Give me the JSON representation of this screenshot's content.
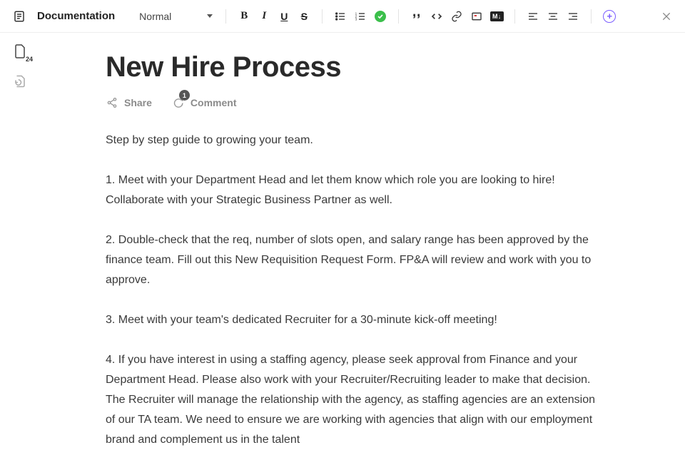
{
  "toolbar": {
    "doc_type": "Documentation",
    "style_dropdown": "Normal",
    "bold": "B",
    "italic": "I",
    "underline": "U",
    "strike": "S",
    "md_label": "M↓",
    "plus": "+"
  },
  "gutter": {
    "page_count": "24"
  },
  "document": {
    "title": "New Hire Process",
    "share_label": "Share",
    "comment_label": "Comment",
    "comment_count": "1",
    "intro": "Step by step guide to growing your team.",
    "step1": "1. Meet with your Department Head and let them know which role you are looking to hire!  Collaborate with your Strategic Business Partner as well.",
    "step2": "2. Double-check that the req, number of slots open, and salary range has been approved by the finance team.  Fill out this New Requisition Request Form.  FP&A will review and work with you to approve.",
    "step3": "3. Meet with your team's dedicated Recruiter for a 30-minute kick-off meeting!",
    "step4": "4. If you have interest in using a staffing agency, please seek approval from Finance and your Department Head.  Please also work with your Recruiter/Recruiting leader to make that decision.  The Recruiter will manage the relationship with the agency, as staffing agencies are an extension of our TA team.  We need to ensure we are working with agencies that align with our employment brand and complement us in the talent"
  }
}
